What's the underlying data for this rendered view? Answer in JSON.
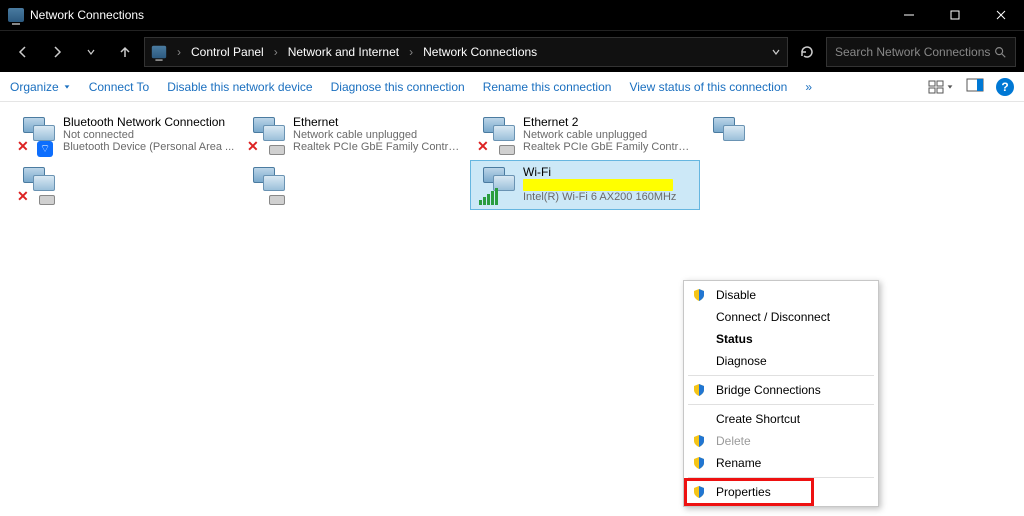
{
  "window": {
    "title": "Network Connections"
  },
  "breadcrumb": [
    "Control Panel",
    "Network and Internet",
    "Network Connections"
  ],
  "search": {
    "placeholder": "Search Network Connections"
  },
  "commands": {
    "organize": "Organize",
    "connect_to": "Connect To",
    "disable": "Disable this network device",
    "diagnose": "Diagnose this connection",
    "rename": "Rename this connection",
    "view_status": "View status of this connection"
  },
  "connections": [
    {
      "name": "Bluetooth Network Connection",
      "status": "Not connected",
      "device": "Bluetooth Device (Personal Area ...",
      "icon": "bluetooth",
      "error": true
    },
    {
      "name": "Ethernet",
      "status": "Network cable unplugged",
      "device": "Realtek PCIe GbE Family Controller",
      "icon": "ethernet",
      "error": true
    },
    {
      "name": "Ethernet 2",
      "status": "Network cable unplugged",
      "device": "Realtek PCIe GbE Family Controlle...",
      "icon": "ethernet",
      "error": true
    },
    {
      "name": "",
      "status": "",
      "device": "",
      "icon": "redacted",
      "error": false
    },
    {
      "name": "",
      "status": "",
      "device": "",
      "icon": "disconnected",
      "error": true
    },
    {
      "name": "",
      "status": "",
      "device": "",
      "icon": "disconnected",
      "error": false
    },
    {
      "name": "Wi-Fi",
      "status": "",
      "device": "Intel(R) Wi-Fi 6 AX200 160MHz",
      "icon": "wifi",
      "selected": true
    }
  ],
  "context_menu": {
    "items": [
      {
        "label": "Disable",
        "shield": true
      },
      {
        "label": "Connect / Disconnect"
      },
      {
        "label": "Status",
        "bold": true
      },
      {
        "label": "Diagnose"
      },
      {
        "sep": true
      },
      {
        "label": "Bridge Connections",
        "shield": true
      },
      {
        "sep": true
      },
      {
        "label": "Create Shortcut"
      },
      {
        "label": "Delete",
        "shield": true,
        "disabled": true
      },
      {
        "label": "Rename",
        "shield": true
      },
      {
        "sep": true
      },
      {
        "label": "Properties",
        "shield": true,
        "highlight": true
      }
    ]
  }
}
